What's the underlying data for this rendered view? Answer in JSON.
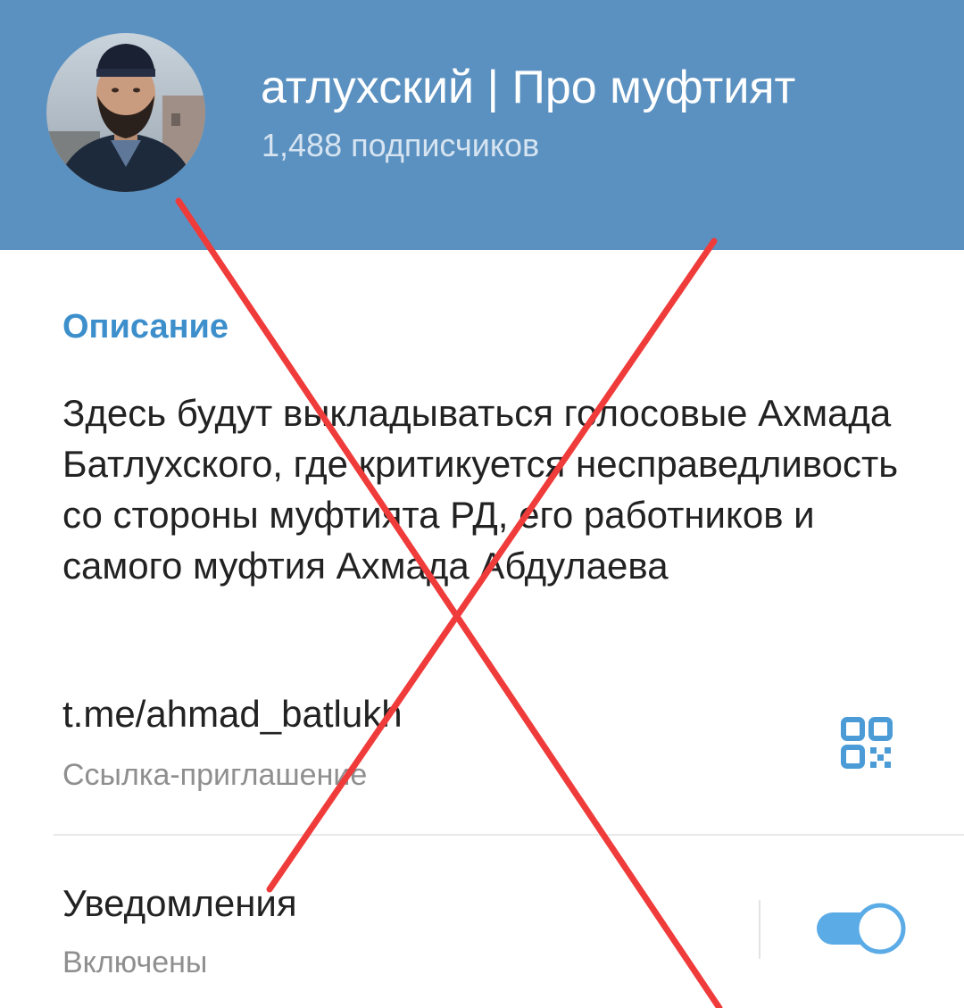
{
  "header": {
    "title": "атлухский | Про муфтият",
    "subscribers": "1,488 подписчиков"
  },
  "description": {
    "section_title": "Описание",
    "text": "Здесь будут выкладываться голосовые Ахмада Батлухского, где критикуется несправедливость со стороны муфтията РД, его работников и самого муфтия Ахмада Абдулаева"
  },
  "invite": {
    "link": "t.me/ahmad_batlukh",
    "caption": "Ссылка-приглашение",
    "qr_icon": "qr-code-icon"
  },
  "notifications": {
    "title": "Уведомления",
    "status": "Включены",
    "enabled": true
  },
  "colors": {
    "header_bg": "#5b91c0",
    "accent": "#3d8fcc",
    "toggle": "#5aabe6",
    "cross_mark": "#f03b3b"
  }
}
